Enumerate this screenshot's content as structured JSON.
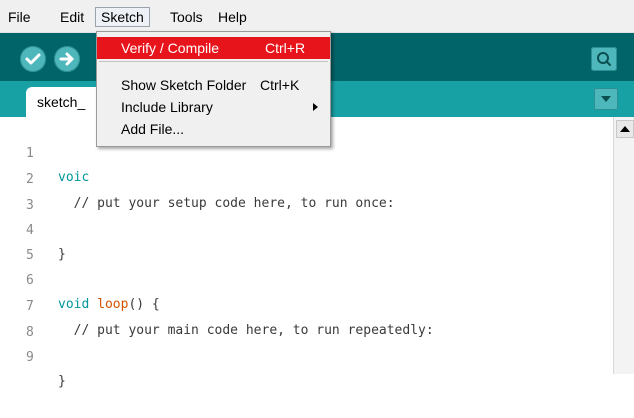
{
  "menubar": {
    "items": [
      "File",
      "Edit",
      "Sketch",
      "Tools",
      "Help"
    ]
  },
  "toolbar": {
    "verify_icon": "check-icon",
    "upload_icon": "arrow-right-icon",
    "serial_monitor_icon": "magnifier-icon"
  },
  "tabs": {
    "current": "sketch_",
    "menu_icon": "chevron-down-icon"
  },
  "sketch_menu": {
    "items": [
      {
        "label": "Verify / Compile",
        "shortcut": "Ctrl+R"
      },
      {
        "label": "Show Sketch Folder",
        "shortcut": "Ctrl+K"
      },
      {
        "label": "Include Library",
        "shortcut": ""
      },
      {
        "label": "Add File...",
        "shortcut": ""
      }
    ],
    "highlight_color": "#e8141b"
  },
  "editor": {
    "lines": [
      {
        "num": "1",
        "keyword": "voic",
        "rest": ""
      },
      {
        "num": "2",
        "text": "  // put your setup code here, to run once:"
      },
      {
        "num": "3",
        "text": ""
      },
      {
        "num": "4",
        "text": "}"
      },
      {
        "num": "5",
        "text": ""
      },
      {
        "num": "6",
        "keyword": "void",
        "func": "loop",
        "rest": "() {"
      },
      {
        "num": "7",
        "text": "  // put your main code here, to run repeatedly:"
      },
      {
        "num": "8",
        "text": ""
      },
      {
        "num": "9",
        "text": "}"
      }
    ]
  },
  "colors": {
    "toolbar_bg": "#006468",
    "tabstrip_bg": "#17a1a5",
    "button_bg": "#4db7bb",
    "keyword": "#00979c",
    "function": "#d35400"
  }
}
